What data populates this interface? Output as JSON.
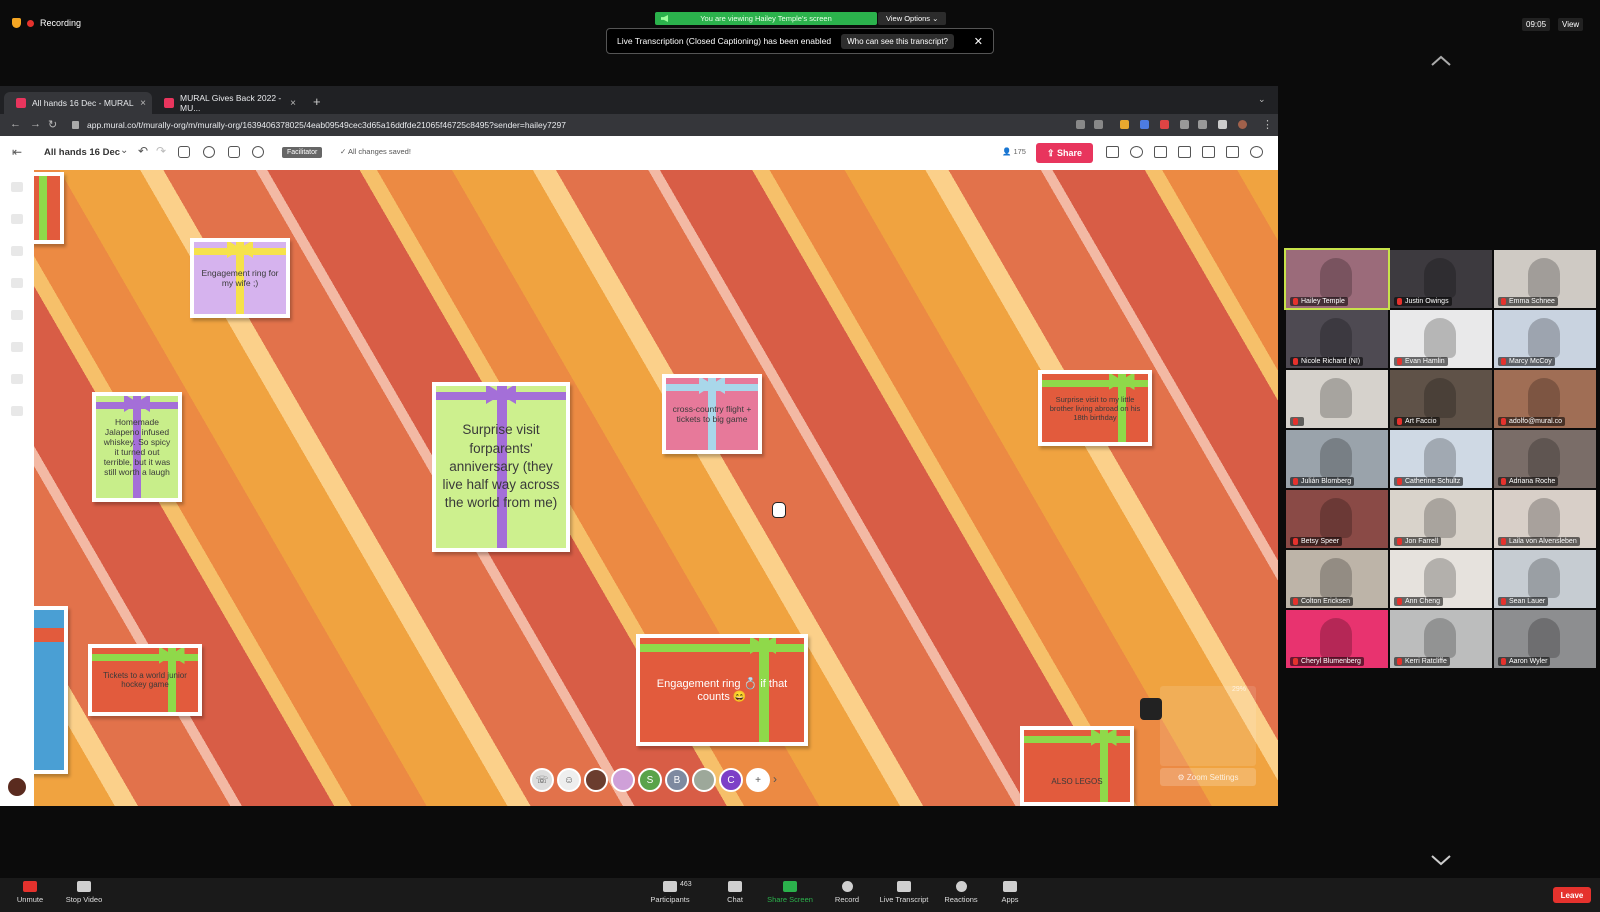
{
  "zoom": {
    "recording_label": "Recording",
    "viewing_banner": "You are viewing Hailey Temple's screen",
    "view_options": "View Options ⌄",
    "clock": "09:05",
    "view_button": "View",
    "caption_banner": {
      "text": "Live Transcription (Closed Captioning) has been enabled",
      "who_button": "Who can see this transcript?",
      "close": "✕"
    },
    "participants": [
      {
        "name": "Hailey Temple",
        "bg": "#9b6b7a"
      },
      {
        "name": "Justin Owings",
        "bg": "#3d3a3f"
      },
      {
        "name": "Emma Schnee",
        "bg": "#cfcac4"
      },
      {
        "name": "Nicole Richard (NI)",
        "bg": "#4e4a52"
      },
      {
        "name": "Evan Hamlin",
        "bg": "#e9e9ea"
      },
      {
        "name": "Marcy McCoy",
        "bg": "#c9d3e0"
      },
      {
        "name": "",
        "bg": "#d6d2cc"
      },
      {
        "name": "Art Faccio",
        "bg": "#5f5248"
      },
      {
        "name": "adolfo@mural.co",
        "bg": "#a06e55"
      },
      {
        "name": "Julián Blomberg",
        "bg": "#9aa3ab"
      },
      {
        "name": "Catherine Schultz",
        "bg": "#cfd9e4"
      },
      {
        "name": "Adriana Roche",
        "bg": "#7a6d68"
      },
      {
        "name": "Betsy Speer",
        "bg": "#8a4a46"
      },
      {
        "name": "Jon Farrell",
        "bg": "#d9d3cb"
      },
      {
        "name": "Laila von Alvensleben",
        "bg": "#d8cfc8"
      },
      {
        "name": "Colton Ericksen",
        "bg": "#bdb4a8"
      },
      {
        "name": "Ann Cheng",
        "bg": "#e6e2dd"
      },
      {
        "name": "Sean Lauer",
        "bg": "#c6ccd2"
      },
      {
        "name": "Cheryl Blumenberg",
        "bg": "#e8336f"
      },
      {
        "name": "Kerri Ratcliffe",
        "bg": "#bcbdbd"
      },
      {
        "name": "Aaron Wyler",
        "bg": "#8d8e90"
      }
    ],
    "bottom": {
      "unmute": "Unmute",
      "stop_video": "Stop Video",
      "participants": "Participants",
      "participant_count": "463",
      "chat": "Chat",
      "share_screen": "Share Screen",
      "record": "Record",
      "live_transcript": "Live Transcript",
      "reactions": "Reactions",
      "apps": "Apps",
      "leave": "Leave"
    }
  },
  "browser": {
    "tabs": [
      {
        "label": "All hands 16 Dec - MURAL"
      },
      {
        "label": "MURAL Gives Back 2022 - MU..."
      }
    ],
    "new_tab": "+",
    "url": "app.mural.co/t/murally-org/m/murally-org/1639406378025/4eab09549cec3d65a16ddfde21065f46725c8495?sender=hailey7297"
  },
  "mural": {
    "board_title": "All hands 16 Dec",
    "facilitator": "Facilitator",
    "saved_status": "All changes saved!",
    "member_count": "175",
    "share_label": "Share",
    "zoom_settings": "Zoom Settings",
    "zoom_percent": "29%",
    "avatars": [
      "B",
      "C",
      "S"
    ],
    "gifts": [
      {
        "text": "Engagement ring for my wife ;)",
        "color": "#d6b3ee",
        "ribbon": "#f6e24b"
      },
      {
        "text": "Homemade Jalapeno infused whiskey. So spicy it turned out terrible, but it was still worth a laugh",
        "color": "#c8ee8a",
        "ribbon": "#a46fd8"
      },
      {
        "text": "Surprise visit forparents' anniversary (they live half way across the world from me)",
        "color": "#cdf08e",
        "ribbon": "#a46fd8"
      },
      {
        "text": "cross-country flight + tickets to big game",
        "color": "#e7799a",
        "ribbon": "#a9d7ea"
      },
      {
        "text": "Surprise visit to my little brother living abroad on his 18th birthday",
        "color": "#e25b3d",
        "ribbon": "#8fd94a"
      },
      {
        "text": "Tickets to a world junior hockey game",
        "color": "#e25b3d",
        "ribbon": "#8fd94a"
      },
      {
        "text": "Engagement ring 💍 if that counts 😄",
        "color": "#e25b3d",
        "ribbon": "#8fd94a"
      },
      {
        "text": "ALSO LEGOS",
        "color": "#e25b3d",
        "ribbon": "#8fd94a"
      }
    ]
  }
}
